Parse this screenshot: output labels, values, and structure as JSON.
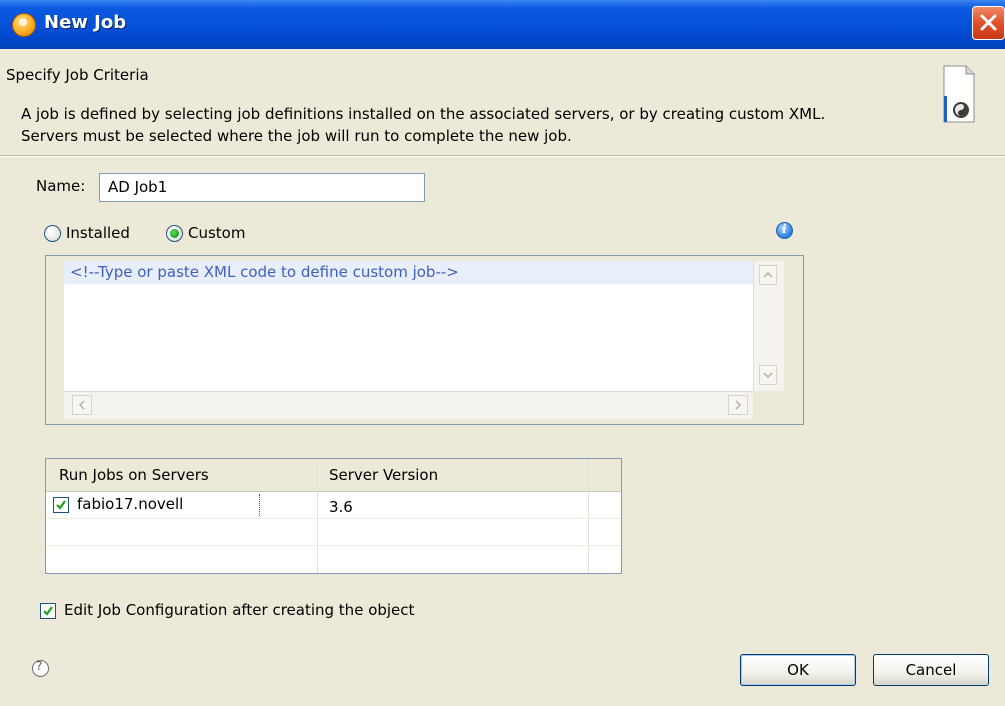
{
  "window": {
    "title": "New Job"
  },
  "header": {
    "title": "Specify Job Criteria",
    "description_line1": "A job is defined by selecting job definitions installed on the associated servers, or by creating custom XML.",
    "description_line2": "Servers must be selected where the job will run to complete the new job."
  },
  "form": {
    "name_label": "Name:",
    "name_value": "AD Job1",
    "radio_installed": "Installed",
    "radio_custom": "Custom",
    "selected_radio": "Custom",
    "xml_placeholder": "<!--Type or paste XML code to define custom job-->"
  },
  "servers_table": {
    "columns": [
      "Run Jobs on Servers",
      "Server Version"
    ],
    "rows": [
      {
        "checked": true,
        "server": "fabio17.novell",
        "version": "3.6"
      }
    ]
  },
  "options": {
    "edit_config_label": "Edit Job Configuration after creating the object",
    "edit_config_checked": true
  },
  "buttons": {
    "ok": "OK",
    "cancel": "Cancel"
  },
  "icons": {
    "title": "app-orb-icon",
    "close": "close-icon",
    "wizard": "wizard-banner-icon",
    "info": "info-icon",
    "help": "help-icon"
  },
  "colors": {
    "titlebar": "#0551d8",
    "close_button": "#e0502a",
    "xml_comment": "#3f5fbf",
    "dialog_bg": "#ece9d8",
    "checkbox_mark": "#21a121"
  }
}
